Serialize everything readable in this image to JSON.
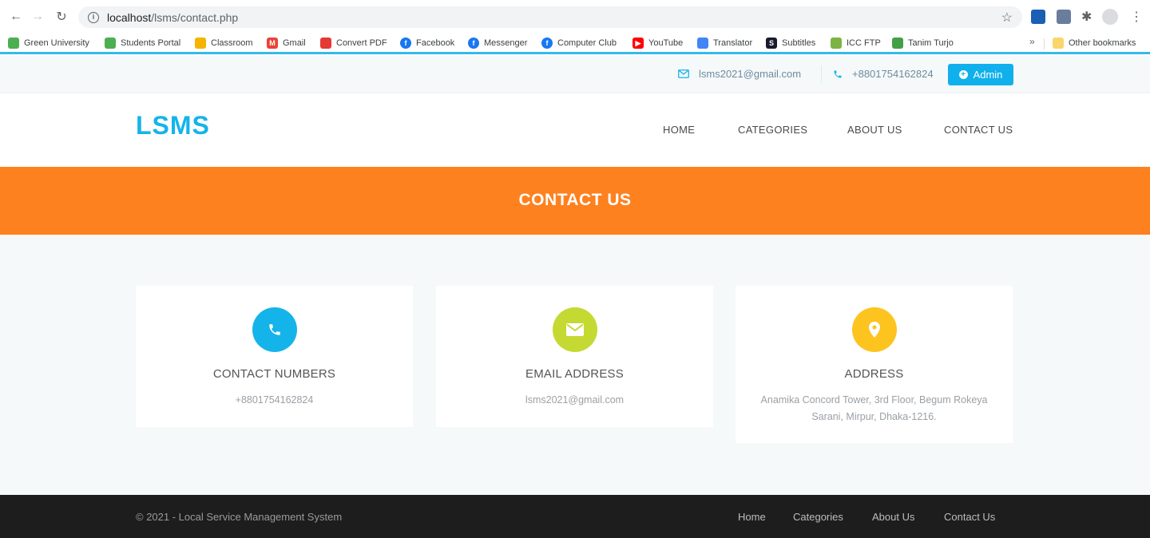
{
  "browser": {
    "url_host": "localhost",
    "url_path": "/lsms/contact.php",
    "bookmarks": [
      {
        "label": "Green University",
        "color": "#4caf50"
      },
      {
        "label": "Students Portal",
        "color": "#4caf50"
      },
      {
        "label": "Classroom",
        "color": "#f4b400"
      },
      {
        "label": "Gmail",
        "color": "#ea4335"
      },
      {
        "label": "Convert PDF",
        "color": "#e53935"
      },
      {
        "label": "Facebook",
        "color": "#1877f2"
      },
      {
        "label": "Messenger",
        "color": "#1877f2"
      },
      {
        "label": "Computer Club",
        "color": "#1877f2"
      },
      {
        "label": "YouTube",
        "color": "#ff0000"
      },
      {
        "label": "Translator",
        "color": "#4285f4"
      },
      {
        "label": "Subtitles",
        "color": "#1a1a2e"
      },
      {
        "label": "ICC FTP",
        "color": "#7cb342"
      },
      {
        "label": "Tanim Turjo",
        "color": "#43a047"
      }
    ],
    "more_label": "»",
    "other_bookmarks": "Other bookmarks"
  },
  "topbar": {
    "email": "lsms2021@gmail.com",
    "phone": "+8801754162824",
    "admin_label": "Admin"
  },
  "header": {
    "logo": "LSMS",
    "nav": [
      "HOME",
      "CATEGORIES",
      "ABOUT US",
      "CONTACT US"
    ]
  },
  "banner": {
    "title": "CONTACT US"
  },
  "cards": [
    {
      "title": "CONTACT NUMBERS",
      "text": "+8801754162824",
      "color": "#14b4ea",
      "icon": "phone-icon"
    },
    {
      "title": "EMAIL ADDRESS",
      "text": "lsms2021@gmail.com",
      "color": "#c5d933",
      "icon": "envelope-icon"
    },
    {
      "title": "ADDRESS",
      "text": "Anamika Concord Tower, 3rd Floor, Begum Rokeya Sarani, Mirpur, Dhaka-1216.",
      "color": "#fdc420",
      "icon": "location-pin-icon"
    }
  ],
  "footer": {
    "copyright": "© 2021 - Local Service Management System",
    "links": [
      "Home",
      "Categories",
      "About Us",
      "Contact Us"
    ]
  }
}
